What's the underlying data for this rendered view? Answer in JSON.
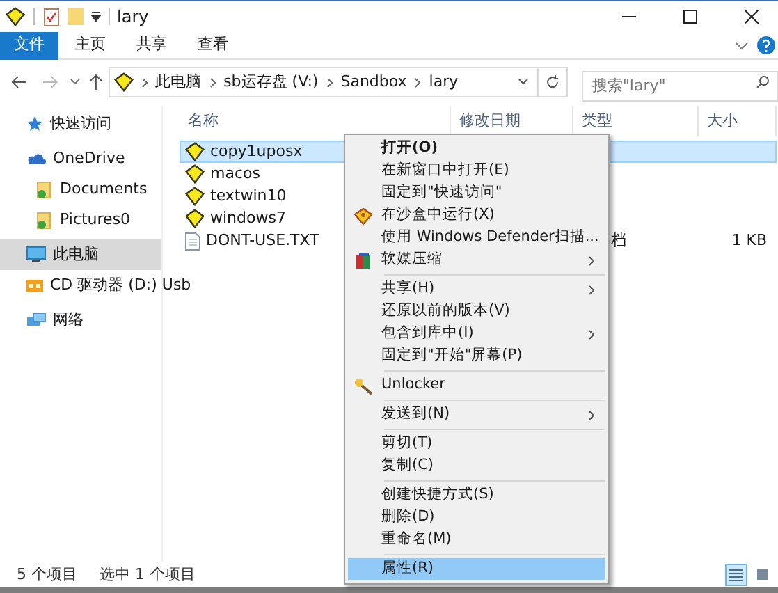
{
  "window": {
    "title": "lary"
  },
  "ribbon_tabs": [
    {
      "label": "文件",
      "selected": true
    },
    {
      "label": "主页",
      "selected": false
    },
    {
      "label": "共享",
      "selected": false
    },
    {
      "label": "查看",
      "selected": false
    }
  ],
  "address": {
    "crumbs": [
      "此电脑",
      "sb运存盘 (V:)",
      "Sandbox",
      "lary"
    ]
  },
  "search": {
    "placeholder": "搜索\"lary\""
  },
  "sidebar": {
    "items": [
      {
        "label": "快速访问",
        "kind": "star",
        "selected": false
      },
      {
        "label": "OneDrive",
        "kind": "cloud",
        "selected": false,
        "children": [
          {
            "label": "Documents",
            "kind": "folder",
            "selected": false
          },
          {
            "label": "Pictures0",
            "kind": "folder",
            "selected": false
          }
        ]
      },
      {
        "label": "此电脑",
        "kind": "pc",
        "selected": true
      },
      {
        "label": "CD 驱动器 (D:) Usb",
        "kind": "drive",
        "selected": false
      },
      {
        "label": "网络",
        "kind": "network",
        "selected": false
      }
    ]
  },
  "table": {
    "columns": [
      "名称",
      "修改日期",
      "类型",
      "大小"
    ],
    "rows": [
      {
        "name": "copy1uposx",
        "kind": "sandbox",
        "selected": true
      },
      {
        "name": "macos",
        "kind": "sandbox",
        "selected": false
      },
      {
        "name": "textwin10",
        "kind": "sandbox",
        "selected": false
      },
      {
        "name": "windows7",
        "kind": "sandbox",
        "selected": false
      },
      {
        "name": "DONT-USE.TXT",
        "kind": "file",
        "selected": false,
        "type": "档",
        "size": "1 KB"
      }
    ]
  },
  "context_menu": {
    "groups": [
      [
        {
          "label": "打开(O)",
          "bold": true,
          "submenu": false,
          "selected": false
        },
        {
          "label": "在新窗口中打开(E)",
          "bold": false,
          "submenu": false,
          "selected": false
        },
        {
          "label": "固定到\"快速访问\"",
          "bold": false,
          "submenu": false,
          "selected": false
        },
        {
          "label": "在沙盒中运行(X)",
          "bold": false,
          "submenu": false,
          "selected": false,
          "kind": "sandbox"
        },
        {
          "label": "使用 Windows Defender扫描...",
          "bold": false,
          "submenu": false,
          "selected": false
        },
        {
          "label": "软媒压缩",
          "bold": false,
          "submenu": true,
          "selected": false,
          "kind": "archive"
        }
      ],
      [
        {
          "label": "共享(H)",
          "bold": false,
          "submenu": true,
          "selected": false
        },
        {
          "label": "还原以前的版本(V)",
          "bold": false,
          "submenu": false,
          "selected": false
        },
        {
          "label": "包含到库中(I)",
          "bold": false,
          "submenu": true,
          "selected": false
        },
        {
          "label": "固定到\"开始\"屏幕(P)",
          "bold": false,
          "submenu": false,
          "selected": false
        }
      ],
      [
        {
          "label": "Unlocker",
          "bold": false,
          "submenu": false,
          "selected": false,
          "kind": "unlocker"
        }
      ],
      [
        {
          "label": "发送到(N)",
          "bold": false,
          "submenu": true,
          "selected": false
        }
      ],
      [
        {
          "label": "剪切(T)",
          "bold": false,
          "submenu": false,
          "selected": false
        },
        {
          "label": "复制(C)",
          "bold": false,
          "submenu": false,
          "selected": false
        }
      ],
      [
        {
          "label": "创建快捷方式(S)",
          "bold": false,
          "submenu": false,
          "selected": false
        },
        {
          "label": "删除(D)",
          "bold": false,
          "submenu": false,
          "selected": false
        },
        {
          "label": "重命名(M)",
          "bold": false,
          "submenu": false,
          "selected": false
        }
      ],
      [
        {
          "label": "属性(R)",
          "bold": false,
          "submenu": false,
          "selected": true
        }
      ]
    ]
  },
  "status_bar": {
    "items": [
      "5 个项目",
      "选中 1 个项目"
    ],
    "view_buttons": [
      {
        "kind": "details",
        "selected": true
      },
      {
        "kind": "tiles",
        "selected": false
      }
    ]
  }
}
